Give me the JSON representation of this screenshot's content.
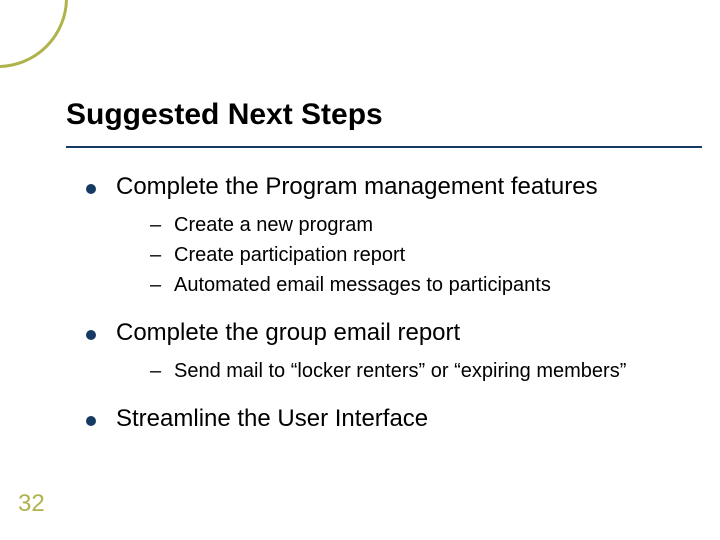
{
  "slide": {
    "title": "Suggested Next Steps",
    "page_number": "32",
    "bullets": {
      "b1": {
        "text": "Complete the Program management features",
        "subs": {
          "s1": "Create a new program",
          "s2": "Create participation report",
          "s3": "Automated email messages to participants"
        }
      },
      "b2": {
        "text": "Complete the group email report",
        "subs": {
          "s1": "Send mail to “locker renters” or “expiring members”"
        }
      },
      "b3": {
        "text": "Streamline the User Interface"
      }
    },
    "accent_color": "#b0b34a",
    "rule_color": "#163a63"
  }
}
